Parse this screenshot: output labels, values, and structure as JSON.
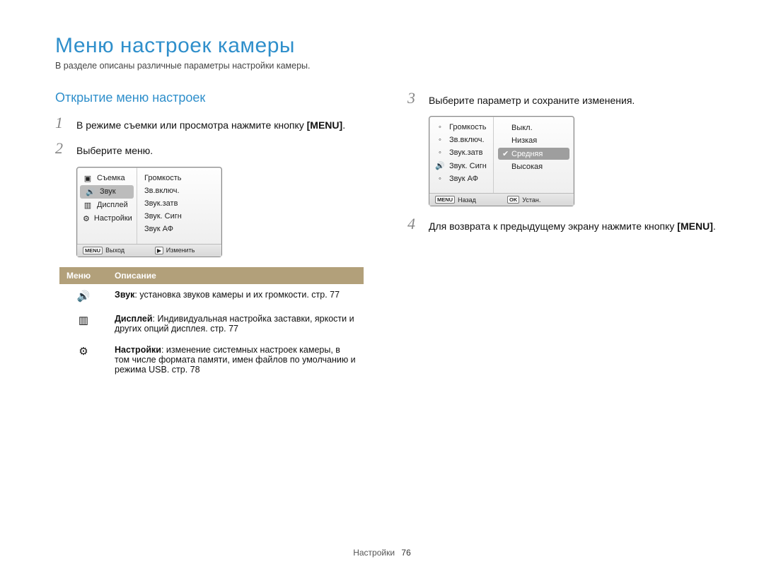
{
  "title": "Меню настроек камеры",
  "intro": "В разделе описаны различные параметры настройки камеры.",
  "section_open": "Открытие меню настроек",
  "steps": {
    "s1": {
      "num": "1",
      "text_a": "В режиме съемки или просмотра нажмите кнопку",
      "menu": "MENU",
      "text_b": "."
    },
    "s2": {
      "num": "2",
      "text": "Выберите меню."
    },
    "s3": {
      "num": "3",
      "text": "Выберите параметр и сохраните изменения."
    },
    "s4": {
      "num": "4",
      "text_a": "Для возврата к предыдущему экрану нажмите кнопку",
      "menu": "MENU",
      "text_b": "."
    }
  },
  "lcd1": {
    "left": [
      {
        "icon": "camera",
        "label": "Съемка"
      },
      {
        "icon": "sound",
        "label": "Звук",
        "selected": true
      },
      {
        "icon": "display",
        "label": "Дисплей"
      },
      {
        "icon": "gear",
        "label": "Настройки"
      }
    ],
    "right": [
      "Громкость",
      "Зв.включ.",
      "Звук.затв",
      "Звук. Сигн",
      "Звук АФ"
    ],
    "foot_left_key": "MENU",
    "foot_left": "Выход",
    "foot_right_key": "▶",
    "foot_right": "Изменить"
  },
  "lcd2": {
    "left_icon_row": "sound",
    "left": [
      "Громкость",
      "Зв.включ.",
      "Звук.затв",
      "Звук. Сигн",
      "Звук АФ"
    ],
    "right": [
      {
        "label": "Выкл."
      },
      {
        "label": "Низкая"
      },
      {
        "label": "Средняя",
        "selected": true
      },
      {
        "label": "Высокая"
      }
    ],
    "foot_left_key": "MENU",
    "foot_left": "Назад",
    "foot_right_key": "OK",
    "foot_right": "Устан."
  },
  "table": {
    "h1": "Меню",
    "h2": "Описание",
    "rows": [
      {
        "icon": "sound",
        "title": "Звук",
        "text": ": установка звуков камеры и их громкости. стр. 77"
      },
      {
        "icon": "display",
        "title": "Дисплей",
        "text": ": Индивидуальная настройка заставки, яркости и других опций дисплея. стр. 77"
      },
      {
        "icon": "gear",
        "title": "Настройки",
        "text": ": изменение системных настроек камеры, в том числе формата памяти, имен файлов по умолчанию и режима USB. стр. 78"
      }
    ]
  },
  "footer": {
    "section": "Настройки",
    "page": "76"
  },
  "icons": {
    "camera": "▣",
    "sound": "🔊",
    "display": "▥",
    "gear": "⚙",
    "check": "✔"
  }
}
